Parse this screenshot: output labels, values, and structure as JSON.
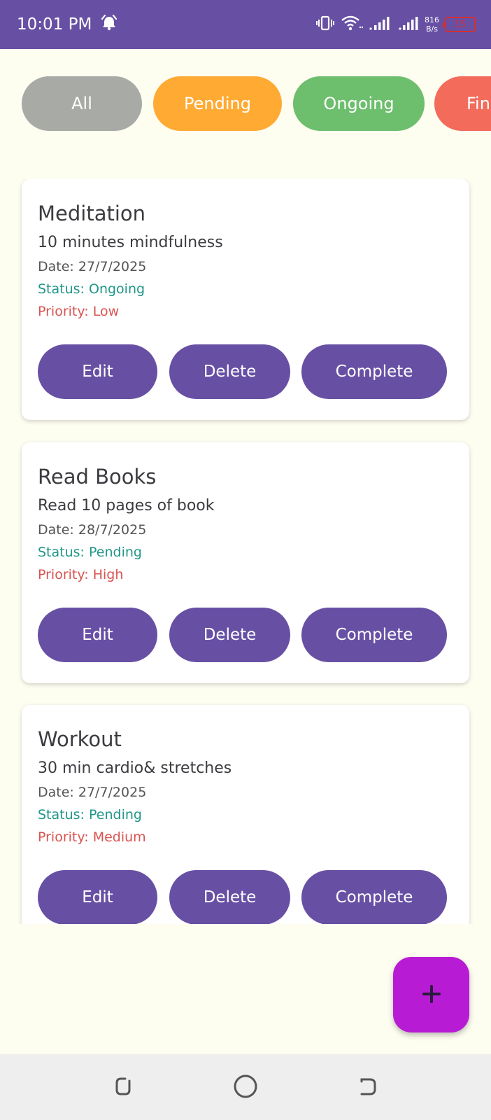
{
  "status_bar": {
    "time": "10:01 PM",
    "net_speed_value": "816",
    "net_speed_unit": "B/s",
    "battery": "15",
    "icons": [
      "alarm-icon",
      "vibrate-icon",
      "wifi-icon",
      "signal-icon",
      "signal-icon",
      "battery-icon"
    ]
  },
  "filters": [
    {
      "label": "All",
      "color": "#a8aaa5"
    },
    {
      "label": "Pending",
      "color": "#ffaa33"
    },
    {
      "label": "Ongoing",
      "color": "#6dbe6d"
    },
    {
      "label": "Fin",
      "color": "#f26b5b"
    }
  ],
  "labels": {
    "date": "Date: ",
    "status": "Status: ",
    "priority": "Priority: "
  },
  "tasks": [
    {
      "title": "Meditation",
      "description": "10 minutes mindfulness",
      "date": "27/7/2025",
      "status": "Ongoing",
      "priority": "Low",
      "buttons": {
        "edit": "Edit",
        "delete": "Delete",
        "complete": "Complete"
      }
    },
    {
      "title": "Read Books",
      "description": "Read 10 pages of book",
      "date": "28/7/2025",
      "status": "Pending",
      "priority": "High",
      "buttons": {
        "edit": "Edit",
        "delete": "Delete",
        "complete": "Complete"
      }
    },
    {
      "title": "Workout",
      "description": "30 min cardio& stretches",
      "date": "27/7/2025",
      "status": "Pending",
      "priority": "Medium",
      "buttons": {
        "edit": "Edit",
        "delete": "Delete",
        "complete": "Complete"
      }
    }
  ],
  "fab": {
    "icon": "plus-icon",
    "color": "#b71cd4"
  },
  "colors": {
    "primary": "#6750a4",
    "background": "#fdfdf0",
    "status_text": "#1f9688",
    "priority_text": "#d9534f"
  },
  "nav_bar": {
    "icons": [
      "recents-icon",
      "home-icon",
      "back-icon"
    ]
  }
}
